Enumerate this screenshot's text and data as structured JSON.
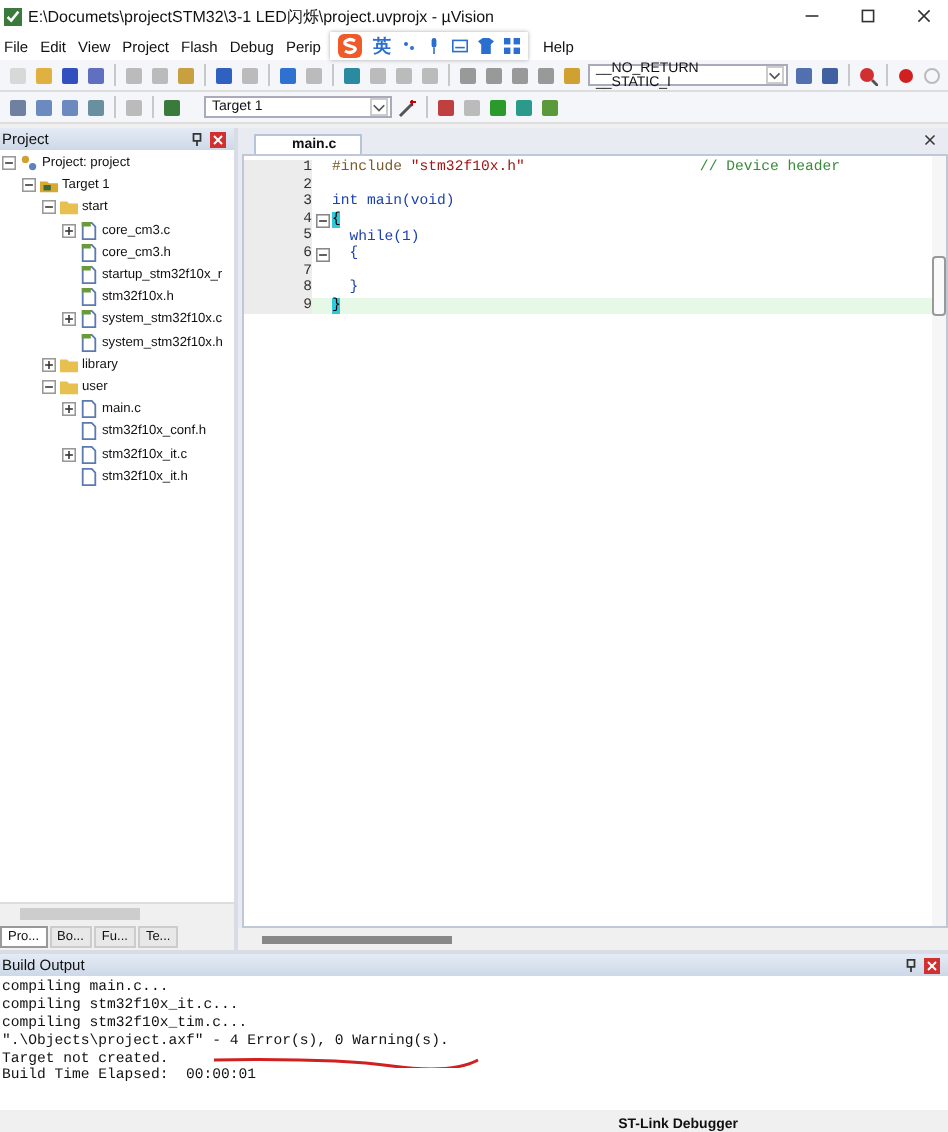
{
  "window": {
    "title": "E:\\Documets\\projectSTM32\\3-1 LED闪烁\\project.uvprojx - µVision"
  },
  "menu": [
    {
      "label": "File"
    },
    {
      "label": "Edit"
    },
    {
      "label": "View"
    },
    {
      "label": "Project"
    },
    {
      "label": "Flash"
    },
    {
      "label": "Debug"
    },
    {
      "label": "Perip"
    },
    {
      "label": "Help"
    }
  ],
  "ime_toolbar": {
    "mode": "英"
  },
  "toolbar": {
    "target": "Target 1",
    "define_box": "__NO_RETURN __STATIC_I"
  },
  "project_panel": {
    "title": "Project",
    "tree": [
      {
        "label": "Project: project",
        "kind": "project",
        "expanded": true,
        "children": [
          {
            "label": "Target 1",
            "kind": "target",
            "expanded": true,
            "children": [
              {
                "label": "start",
                "kind": "folder",
                "expanded": true,
                "children": [
                  {
                    "label": "core_cm3.c",
                    "kind": "file",
                    "expanded": false
                  },
                  {
                    "label": "core_cm3.h",
                    "kind": "file"
                  },
                  {
                    "label": "startup_stm32f10x_r",
                    "kind": "file"
                  },
                  {
                    "label": "stm32f10x.h",
                    "kind": "file"
                  },
                  {
                    "label": "system_stm32f10x.c",
                    "kind": "file",
                    "expanded": false
                  },
                  {
                    "label": "system_stm32f10x.h",
                    "kind": "file"
                  }
                ]
              },
              {
                "label": "library",
                "kind": "folder",
                "expanded": false
              },
              {
                "label": "user",
                "kind": "folder",
                "expanded": true,
                "children": [
                  {
                    "label": "main.c",
                    "kind": "file2",
                    "expanded": false
                  },
                  {
                    "label": "stm32f10x_conf.h",
                    "kind": "file2"
                  },
                  {
                    "label": "stm32f10x_it.c",
                    "kind": "file2",
                    "expanded": false
                  },
                  {
                    "label": "stm32f10x_it.h",
                    "kind": "file2"
                  }
                ]
              }
            ]
          }
        ]
      }
    ],
    "tabs": [
      {
        "label": "Pro...",
        "selected": true
      },
      {
        "label": "Bo...",
        "selected": false
      },
      {
        "label": "Fu...",
        "selected": false
      },
      {
        "label": "Te...",
        "selected": false
      }
    ]
  },
  "editor": {
    "tab": "main.c",
    "lines": [
      {
        "number": "1",
        "segments": [
          {
            "kind": "pp",
            "text": "#include "
          },
          {
            "kind": "str",
            "text": "\"stm32f10x.h\""
          },
          {
            "kind": "comment",
            "text": "                    // Device header"
          }
        ]
      },
      {
        "number": "2"
      },
      {
        "number": "3",
        "segments": [
          {
            "kind": "kw",
            "text": "int"
          },
          {
            "kind": "plain",
            "text": " main(void)"
          }
        ]
      },
      {
        "number": "4",
        "folded": false,
        "segments": [
          {
            "kind": "brace",
            "text": "{"
          }
        ]
      },
      {
        "number": "5",
        "segments": [
          {
            "kind": "kw",
            "text": "  while"
          },
          {
            "kind": "plain",
            "text": "(1)"
          }
        ]
      },
      {
        "number": "6",
        "folded": false,
        "segments": [
          {
            "kind": "plain",
            "text": "  {"
          }
        ]
      },
      {
        "number": "7"
      },
      {
        "number": "8",
        "segments": [
          {
            "kind": "plain",
            "text": "  }"
          }
        ]
      },
      {
        "number": "9",
        "current": true,
        "segments": [
          {
            "kind": "brace",
            "text": "}"
          }
        ]
      }
    ]
  },
  "build_output": {
    "title": "Build Output",
    "lines": [
      "compiling main.c...",
      "compiling stm32f10x_it.c...",
      "compiling stm32f10x_tim.c...",
      "\".\\Objects\\project.axf\" - 4 Error(s), 0 Warning(s).",
      "Target not created.",
      "Build Time Elapsed:  00:00:01"
    ]
  },
  "status_bar": {
    "debugger": "ST-Link Debugger"
  }
}
